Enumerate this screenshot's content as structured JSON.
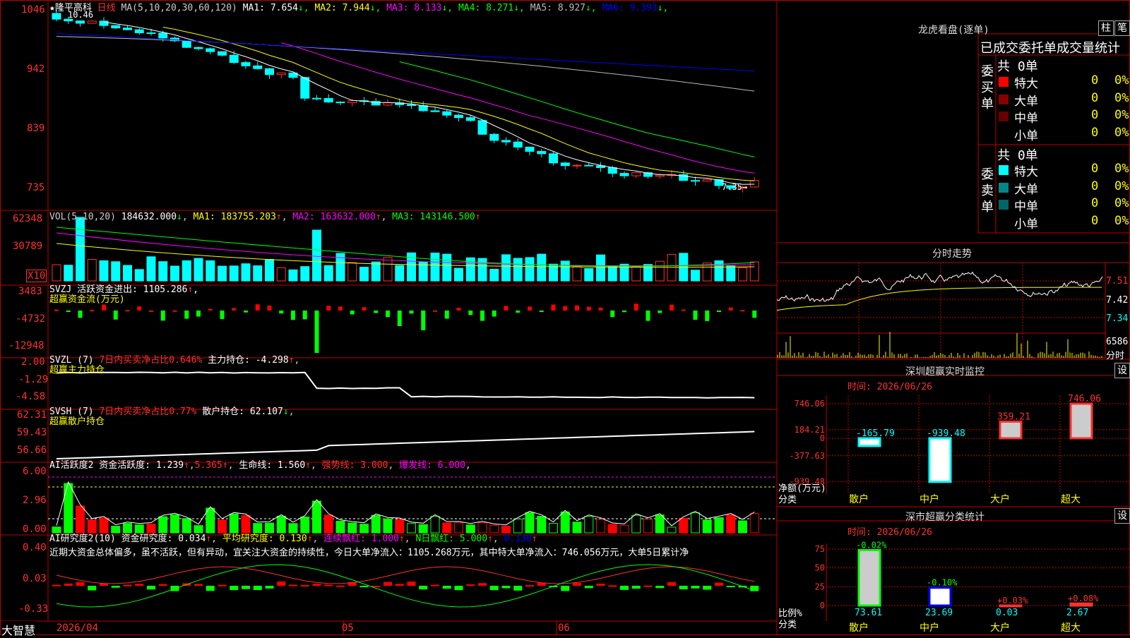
{
  "stock": {
    "name": "★隆平高科",
    "period": "日线",
    "ma_label": "MA(5,10,20,30,60,120)",
    "ma_values": [
      {
        "label": "MA1: 7.654",
        "color": "#ffffff"
      },
      {
        "label": "MA2: 7.944",
        "color": "#ffff00"
      },
      {
        "label": "MA3: 8.133",
        "color": "#ff00ff"
      },
      {
        "label": "MA4: 8.271",
        "color": "#00ff00"
      },
      {
        "label": "MA5: 8.927",
        "color": "#bbbbbb"
      },
      {
        "label": "MA6: 9.393",
        "color": "#0000ff"
      }
    ],
    "high_label": "10.46",
    "low_label": "7.35"
  },
  "price_axis": [
    "1046",
    "942",
    "839",
    "735"
  ],
  "vol": {
    "header": "VOL(5,10,20)",
    "v": "184632.000",
    "ma1": "MA1: 183755.203",
    "ma2": "MA2: 163632.000",
    "ma3": "MA3: 143146.500",
    "axis": [
      "62348",
      "30789"
    ],
    "unit": "X10"
  },
  "svzj": {
    "header": "SVZJ  活跃资金进出: 1105.286",
    "sub": "超赢资金流(万元)",
    "axis": [
      "3483",
      "-4732",
      "-12948"
    ]
  },
  "svzl": {
    "header": "SVZL (7)",
    "ratio": "7日内买卖净占比0.646%",
    "hold": "主力持仓: -4.298",
    "sub": "超赢主力持仓",
    "axis": [
      "2.00",
      "-1.29",
      "-4.58"
    ]
  },
  "svsh": {
    "header": "SVSH (7)",
    "ratio": "7日内买卖净占比0.77%",
    "hold": "散户持仓: 62.107",
    "sub": "超赢散户持仓",
    "axis": [
      "62.31",
      "59.43",
      "56.66"
    ]
  },
  "ai1": {
    "header": "AI活跃度2 资金活跃度: 1.239",
    "v2": "5.365",
    "life": "生命线: 1.560",
    "strong": "强势线: 3.000",
    "burst": "爆发线: 6.000",
    "axis": [
      "6.00",
      "2.96",
      "0.00"
    ]
  },
  "ai2": {
    "header": "AI研究度2(10) 资金研究度: 0.034",
    "avg": "平均研究度: 0.130",
    "red": "连续飘红: 1.000",
    "nred": "N日飘红: 5.000",
    "last": "0.130",
    "text": "近期大资金总体偏多，虽不活跃，但有异动，宜关注大资金的持续性，今日大单净流入：1105.268万元，其中特大单净流入：746.056万元，大单5日累计净",
    "axis": [
      "0.40",
      "0.03",
      "-0.33"
    ]
  },
  "xaxis": {
    "labels": [
      "2026/04",
      "05",
      "06"
    ],
    "brand": "大智慧"
  },
  "lhb": {
    "title": "龙虎看盘(逐单)",
    "btn1": "柱",
    "btn2": "笔",
    "subtitle": "已成交委托单成交量统计",
    "buy": {
      "label": [
        "委",
        "买",
        "单"
      ],
      "total": "共 0单",
      "rows": [
        {
          "name": "特大",
          "v": "0",
          "p": "0%",
          "color": "#ff0000"
        },
        {
          "name": "大单",
          "v": "0",
          "p": "0%",
          "color": "#880000"
        },
        {
          "name": "中单",
          "v": "0",
          "p": "0%",
          "color": "#660000"
        },
        {
          "name": "小单",
          "v": "0",
          "p": "0%",
          "color": "#000000"
        }
      ]
    },
    "sell": {
      "label": [
        "委",
        "卖",
        "单"
      ],
      "total": "共 0单",
      "rows": [
        {
          "name": "特大",
          "v": "0",
          "p": "0%",
          "color": "#00ffff"
        },
        {
          "name": "大单",
          "v": "0",
          "p": "0%",
          "color": "#008888"
        },
        {
          "name": "中单",
          "v": "0",
          "p": "0%",
          "color": "#006666"
        },
        {
          "name": "小单",
          "v": "0",
          "p": "0%",
          "color": "#000000"
        }
      ]
    }
  },
  "intraday": {
    "title": "分时走势",
    "axis": [
      "7.51",
      "7.42",
      "7.34"
    ],
    "vol": "6586",
    "vol_label": "分时"
  },
  "monitor": {
    "title": "深圳超赢实时监控",
    "btn": "设",
    "time": "时间: 2026/06/26",
    "axis": [
      "746.06",
      "184.21",
      "0",
      "-377.63",
      "-939.48"
    ],
    "ylabel": "净额(万元)",
    "xlabel": "分类"
  },
  "classify": {
    "title": "深市超赢分类统计",
    "btn": "设",
    "time": "时间: 2026/06/26",
    "axis": [
      "75",
      "50",
      "25",
      "0"
    ],
    "ylabel": "比例%",
    "xlabel": "分类"
  },
  "chart_data": [
    {
      "type": "bar",
      "title": "深圳超赢实时监控",
      "categories": [
        "散户",
        "中户",
        "大户",
        "超大"
      ],
      "values": [
        -165.79,
        -939.48,
        359.21,
        746.06
      ],
      "ylim": [
        -939.48,
        746.06
      ],
      "ylabel": "净额(万元)",
      "xlabel": "分类"
    },
    {
      "type": "bar",
      "title": "深市超赢分类统计",
      "categories": [
        "散户",
        "中户",
        "大户",
        "超大"
      ],
      "values": [
        73.61,
        23.69,
        0.03,
        2.67
      ],
      "changes": [
        "-0.02%",
        "-0.10%",
        "+0.03%",
        "+0.08%"
      ],
      "ylim": [
        0,
        75
      ],
      "ylabel": "比例%",
      "xlabel": "分类"
    }
  ]
}
